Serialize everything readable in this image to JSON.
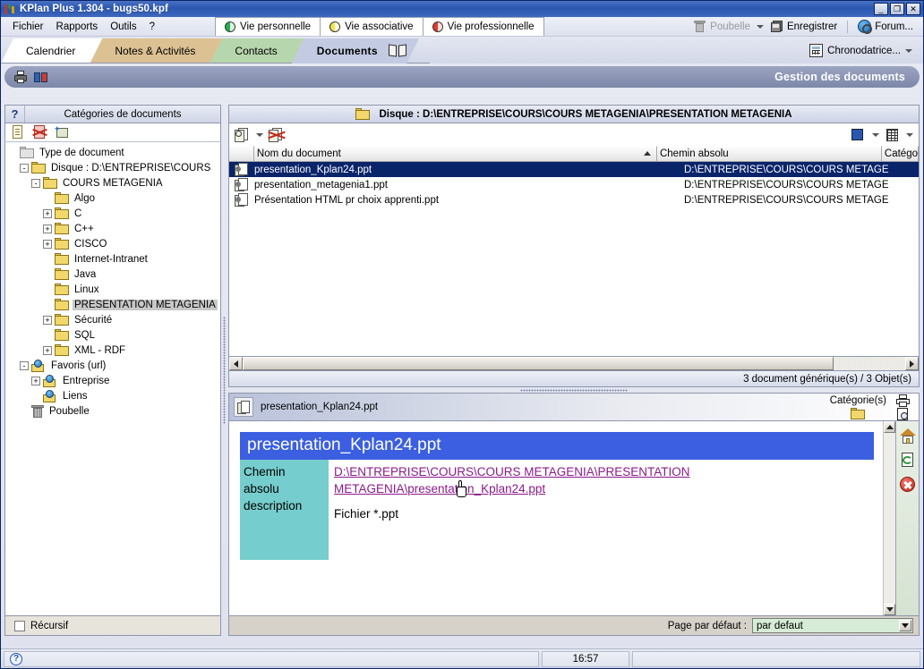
{
  "window": {
    "title": "KPlan Plus 1.304 - bugs50.kpf",
    "minimize": "_",
    "restore": "❐",
    "close": "✕"
  },
  "menu": {
    "items": [
      "Fichier",
      "Rapports",
      "Outils",
      "?"
    ]
  },
  "vie_tabs": [
    {
      "label": "Vie personnelle",
      "color": "#22b14c"
    },
    {
      "label": "Vie associative",
      "color": "#f2e34c"
    },
    {
      "label": "Vie professionnelle",
      "color": "#e03a2f"
    }
  ],
  "topright": {
    "poubelle": "Poubelle",
    "enregistrer": "Enregistrer",
    "forum": "Forum..."
  },
  "main_tabs": [
    {
      "label": "Calendrier",
      "color": "#ffffff",
      "active": false
    },
    {
      "label": "Notes & Activités",
      "color": "#dcc193",
      "active": false
    },
    {
      "label": "Contacts",
      "color": "#b6d6ad",
      "active": false
    },
    {
      "label": "Documents",
      "color": "#c3cbe3",
      "active": true
    }
  ],
  "chronodatrice": {
    "label": "Chronodatrice..."
  },
  "banner": {
    "title": "Gestion des documents"
  },
  "left_panel": {
    "header": "Catégories de documents",
    "help_glyph": "?",
    "recursive_label": "Récursif",
    "tree": [
      {
        "label": "Type de document",
        "depth": 0,
        "expander": "",
        "icon": "folder-gray",
        "selected": false
      },
      {
        "label": "Disque : D:\\ENTREPRISE\\COURS",
        "depth": 1,
        "expander": "-",
        "icon": "folder",
        "selected": false
      },
      {
        "label": "COURS METAGENIA",
        "depth": 2,
        "expander": "-",
        "icon": "folder",
        "selected": false
      },
      {
        "label": "Algo",
        "depth": 3,
        "expander": "",
        "icon": "folder",
        "selected": false
      },
      {
        "label": "C",
        "depth": 3,
        "expander": "+",
        "icon": "folder",
        "selected": false
      },
      {
        "label": "C++",
        "depth": 3,
        "expander": "+",
        "icon": "folder",
        "selected": false
      },
      {
        "label": "CISCO",
        "depth": 3,
        "expander": "+",
        "icon": "folder",
        "selected": false
      },
      {
        "label": "Internet-Intranet",
        "depth": 3,
        "expander": "",
        "icon": "folder",
        "selected": false
      },
      {
        "label": "Java",
        "depth": 3,
        "expander": "",
        "icon": "folder",
        "selected": false
      },
      {
        "label": "Linux",
        "depth": 3,
        "expander": "",
        "icon": "folder",
        "selected": false
      },
      {
        "label": "PRESENTATION METAGENIA",
        "depth": 3,
        "expander": "",
        "icon": "folder",
        "selected": true
      },
      {
        "label": "Sécurité",
        "depth": 3,
        "expander": "+",
        "icon": "folder",
        "selected": false
      },
      {
        "label": "SQL",
        "depth": 3,
        "expander": "",
        "icon": "folder",
        "selected": false
      },
      {
        "label": "XML - RDF",
        "depth": 3,
        "expander": "+",
        "icon": "folder",
        "selected": false
      },
      {
        "label": "Favoris (url)",
        "depth": 1,
        "expander": "-",
        "icon": "url",
        "selected": false
      },
      {
        "label": "Entreprise",
        "depth": 2,
        "expander": "+",
        "icon": "url",
        "selected": false
      },
      {
        "label": "Liens",
        "depth": 2,
        "expander": "",
        "icon": "url",
        "selected": false
      },
      {
        "label": "Poubelle",
        "depth": 1,
        "expander": "",
        "icon": "trash",
        "selected": false
      }
    ]
  },
  "doc_list": {
    "path_label": "Disque : D:\\ENTREPRISE\\COURS\\COURS METAGENIA\\PRESENTATION METAGENIA",
    "columns": [
      "Nom du document",
      "Chemin absolu",
      "Catégo"
    ],
    "rows": [
      {
        "name": "presentation_Kplan24.ppt",
        "path": "D:\\ENTREPRISE\\COURS\\COURS METAGE",
        "selected": true
      },
      {
        "name": "presentation_metagenia1.ppt",
        "path": "D:\\ENTREPRISE\\COURS\\COURS METAGE",
        "selected": false
      },
      {
        "name": "Présentation HTML pr choix apprenti.ppt",
        "path": "D:\\ENTREPRISE\\COURS\\COURS METAGE",
        "selected": false
      }
    ],
    "count_text": "3 document générique(s) / 3 Objet(s)"
  },
  "preview": {
    "file_name": "presentation_Kplan24.ppt",
    "categories_label": "Catégorie(s)",
    "doc_title": "presentation_Kplan24.ppt",
    "fields": [
      {
        "label": "Chemin",
        "value": ""
      },
      {
        "label": "absolu",
        "value": ""
      },
      {
        "label": "description",
        "value": ""
      }
    ],
    "path_link_line1": "D:\\ENTREPRISE\\COURS\\COURS METAGENIA\\PRESENTATION",
    "path_link_line2": "METAGENIA\\presentation_Kplan24.ppt",
    "description_value": "Fichier *.ppt",
    "page_default_label": "Page par défaut :",
    "page_default_value": "par defaut"
  },
  "statusbar": {
    "left": "",
    "time": "16:57",
    "right": ""
  },
  "colors": {
    "title_blue": "#2b57b0",
    "selection_blue": "#0a246a",
    "doc_title_blue": "#3b5fe0",
    "field_teal": "#76cdcd",
    "link_purple": "#8b1a8b",
    "banner_gray": "#7d87a8"
  }
}
